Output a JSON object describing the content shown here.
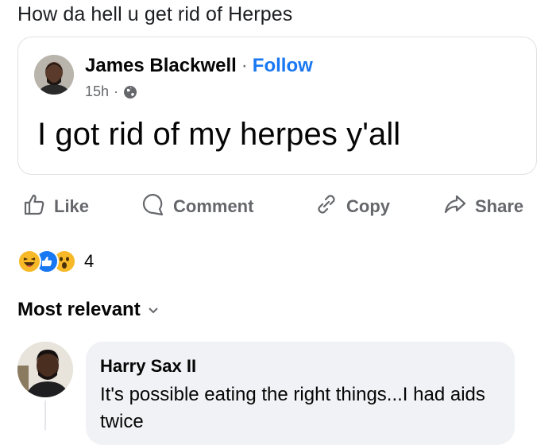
{
  "post": {
    "text": "How da hell u get rid of Herpes"
  },
  "shared_post": {
    "author": "James Blackwell",
    "separator": "·",
    "follow_label": "Follow",
    "time": "15h",
    "meta_separator": "·",
    "privacy_icon": "globe-icon",
    "body": "I got rid of my herpes y'all"
  },
  "actions": {
    "like": "Like",
    "comment": "Comment",
    "copy": "Copy",
    "share": "Share"
  },
  "reactions": {
    "types": [
      "haha",
      "like",
      "wow"
    ],
    "count": "4"
  },
  "comments_sort": {
    "label": "Most relevant"
  },
  "comment": {
    "author": "Harry Sax II",
    "text": "It's possible eating the right things...I had aids twice"
  },
  "colors": {
    "accent": "#1877f2",
    "muted": "#65676b",
    "bubble": "#f0f2f5",
    "reaction_yellow": "#f7b928"
  }
}
